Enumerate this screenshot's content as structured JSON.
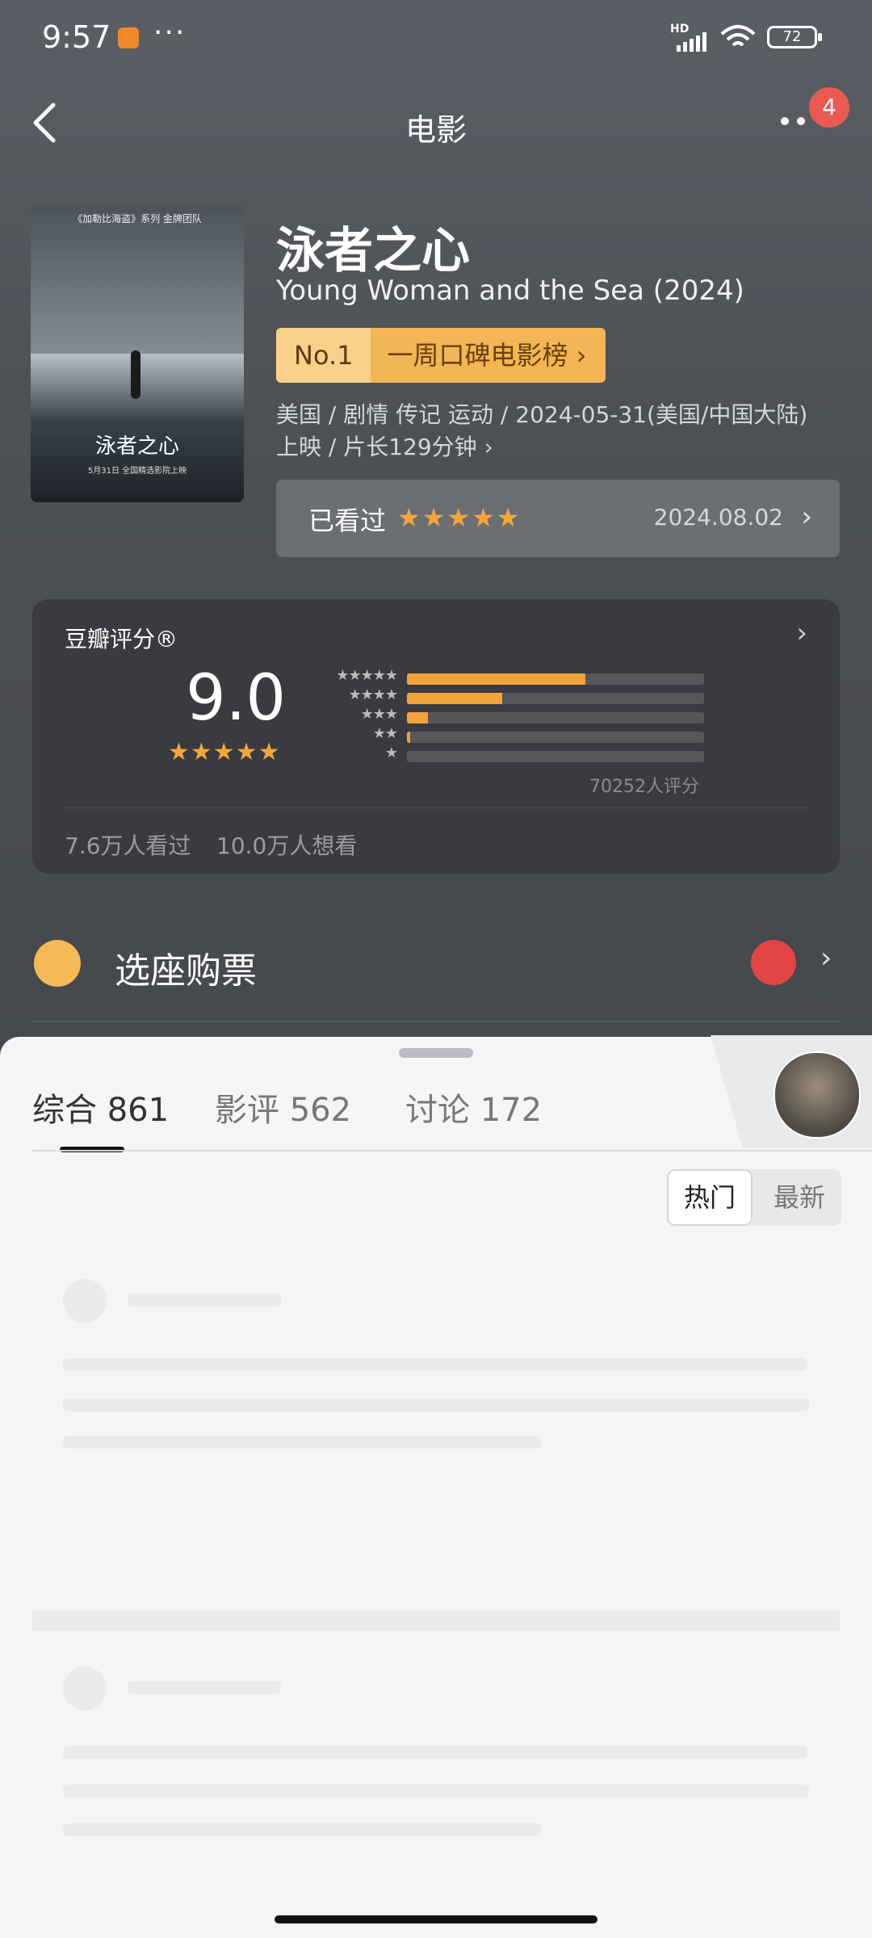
{
  "status_bar": {
    "time": "9:57",
    "more_dots": "···",
    "hd": "HD",
    "battery": "72"
  },
  "nav": {
    "title": "电影",
    "notification_count": "4"
  },
  "poster": {
    "top_text": "《加勒比海盗》系列 金牌团队",
    "title_text": "泳者之心",
    "date_text": "5月31日 全国精选影院上映"
  },
  "movie": {
    "title": "泳者之心",
    "subtitle": "Young Woman and the Sea (2024)",
    "rank_no": "No.1",
    "rank_label": "一周口碑电影榜 ›",
    "meta_line1": "美国 / 剧情 传记 运动 / 2024-05-31(美国/中国大陆)",
    "meta_line2": "上映 / 片长129分钟 ›"
  },
  "watched": {
    "label": "已看过",
    "stars": "★★★★★",
    "date": "2024.08.02",
    "chevron": "›"
  },
  "rating": {
    "label": "豆瓣评分®",
    "score": "9.0",
    "stars": "★★★★★",
    "distribution": [
      {
        "stars": "★★★★★",
        "pct": 0.6
      },
      {
        "stars": "★★★★",
        "pct": 0.32
      },
      {
        "stars": "★★★",
        "pct": 0.07
      },
      {
        "stars": "★★",
        "pct": 0.01
      },
      {
        "stars": "★",
        "pct": 0.0
      }
    ],
    "count": "70252人评分",
    "seen": "7.6万人看过",
    "want": "10.0万人想看",
    "accent": "#f3a33b"
  },
  "buy": {
    "label": "选座购票",
    "chevron": "›"
  },
  "sheet": {
    "tabs": [
      {
        "label": "综合 861",
        "active": true
      },
      {
        "label": "影评 562",
        "active": false
      },
      {
        "label": "讨论 172",
        "active": false
      }
    ],
    "sort_hot": "热门",
    "sort_new": "最新"
  }
}
